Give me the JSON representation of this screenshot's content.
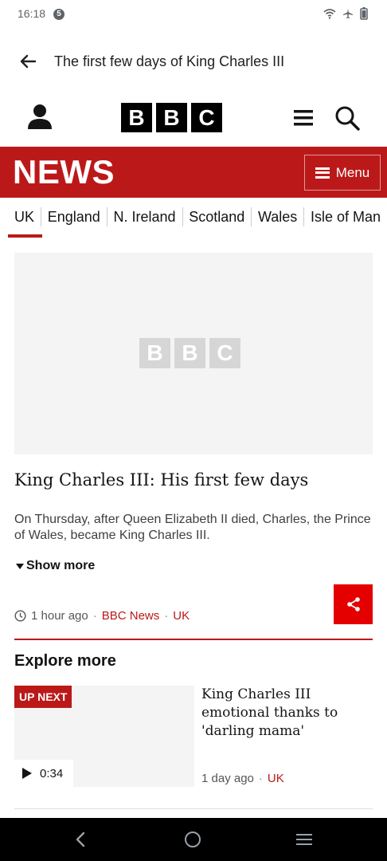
{
  "status_bar": {
    "time": "16:18",
    "notification_count": "5",
    "icons": [
      "wifi-icon",
      "airplane-mode-icon",
      "battery-icon"
    ]
  },
  "app_bar": {
    "title": "The first few days of King Charles III",
    "back_icon": "arrow-left-icon"
  },
  "masthead": {
    "logo_letters": [
      "B",
      "B",
      "C"
    ],
    "icons": [
      "account-icon",
      "hamburger-icon",
      "search-icon"
    ]
  },
  "news_bar": {
    "title": "NEWS",
    "menu_label": "Menu",
    "color": "#bb1919"
  },
  "nav": {
    "tabs": [
      "UK",
      "England",
      "N. Ireland",
      "Scotland",
      "Wales",
      "Isle of Man"
    ],
    "active_index": 0
  },
  "hero": {
    "placeholder_logo": [
      "B",
      "B",
      "C"
    ]
  },
  "article": {
    "headline": "King Charles III: His first few days",
    "summary": "On Thursday, after Queen Elizabeth II died, Charles, the Prince of Wales, became King Charles III.",
    "show_more": "Show more",
    "time": "1 hour ago",
    "source": "BBC News",
    "section": "UK",
    "share_color": "#e50000"
  },
  "explore": {
    "title": "Explore more",
    "items": [
      {
        "badge": "UP NEXT",
        "duration": "0:34",
        "title": "King Charles III emotional thanks to 'darling mama'",
        "time": "1 day ago",
        "section": "UK"
      }
    ]
  },
  "system_nav": {
    "buttons": [
      "back-icon",
      "home-icon",
      "recents-icon"
    ]
  }
}
